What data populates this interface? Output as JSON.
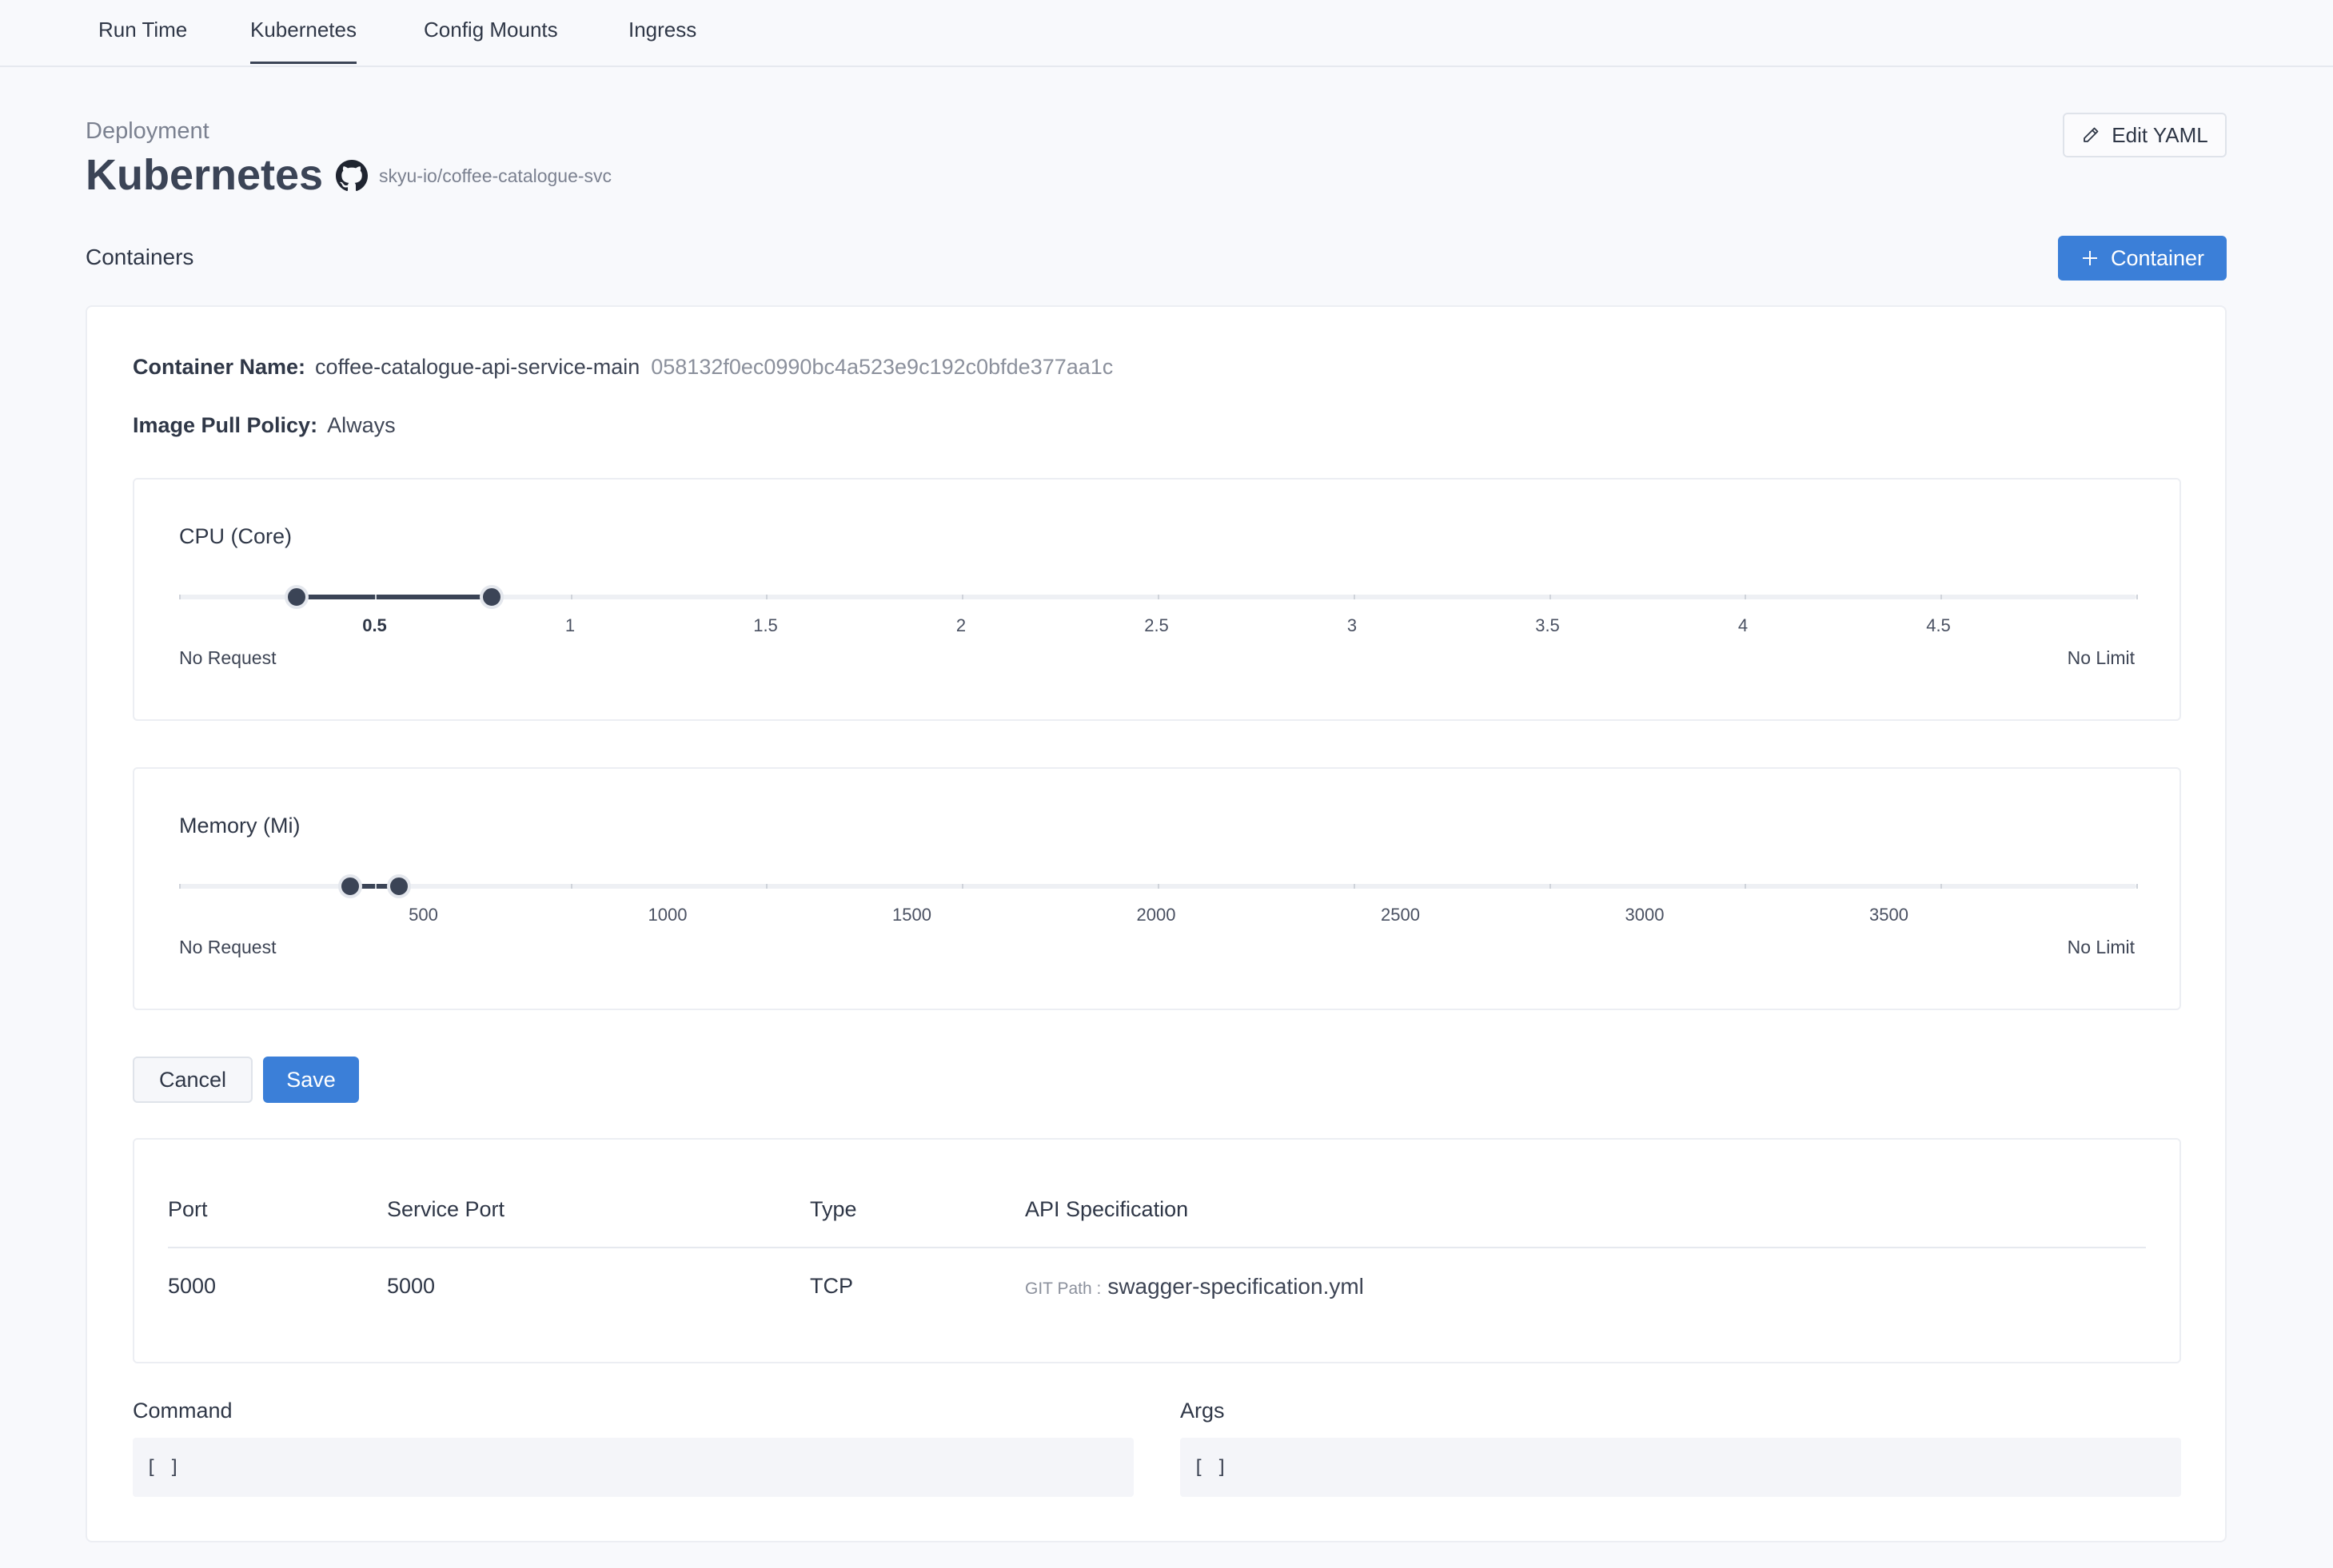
{
  "tabs": [
    {
      "label": "Run Time",
      "active": false
    },
    {
      "label": "Kubernetes",
      "active": true
    },
    {
      "label": "Config Mounts",
      "active": false
    },
    {
      "label": "Ingress",
      "active": false
    }
  ],
  "header": {
    "section_label": "Deployment",
    "title": "Kubernetes",
    "repo_icon": "github-icon",
    "repo": "skyu-io/coffee-catalogue-svc",
    "edit_yaml_label": "Edit YAML",
    "edit_yaml_icon": "pencil-icon"
  },
  "containers": {
    "label": "Containers",
    "add_label": "Container",
    "add_icon": "plus-icon"
  },
  "container": {
    "name_key": "Container Name:",
    "name": "coffee-catalogue-api-service-main",
    "hash": "058132f0ec0990bc4a523e9c192c0bfde377aa1c",
    "pull_policy_key": "Image Pull Policy:",
    "pull_policy": "Always"
  },
  "cpu": {
    "title": "CPU (Core)",
    "marks": [
      "0.5",
      "1",
      "1.5",
      "2",
      "2.5",
      "3",
      "3.5",
      "4",
      "4.5"
    ],
    "active_mark": "0.5",
    "request": 0.3,
    "limit": 0.8,
    "min_label": "No Request",
    "max_label": "No Limit"
  },
  "memory": {
    "title": "Memory (Mi)",
    "marks": [
      "500",
      "1000",
      "1500",
      "2000",
      "2500",
      "3000",
      "3500"
    ],
    "request": 350,
    "limit": 450,
    "min_label": "No Request",
    "max_label": "No Limit"
  },
  "actions": {
    "cancel": "Cancel",
    "save": "Save"
  },
  "ports": {
    "headers": [
      "Port",
      "Service Port",
      "Type",
      "API Specification"
    ],
    "rows": [
      {
        "port": "5000",
        "service_port": "5000",
        "type": "TCP",
        "git_path_key": "GIT Path :",
        "git_path": "swagger-specification.yml"
      }
    ]
  },
  "command": {
    "label": "Command",
    "value": "[ ]"
  },
  "args": {
    "label": "Args",
    "value": "[ ]"
  },
  "colors": {
    "primary": "#3b7fd8",
    "slider": "#3b4456"
  }
}
